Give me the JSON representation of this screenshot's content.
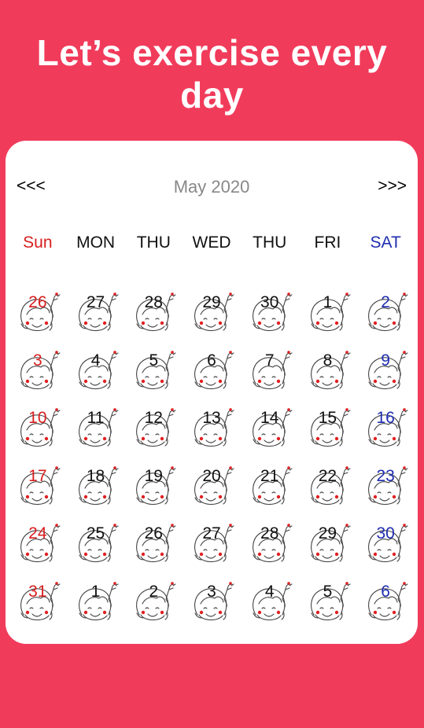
{
  "header": {
    "title": "Let’s exercise every day"
  },
  "calendar": {
    "prev_label": "<<<",
    "next_label": ">>>",
    "month_label": "May 2020",
    "weekdays": [
      "Sun",
      "MON",
      "THU",
      "WED",
      "THU",
      "FRI",
      "SAT"
    ],
    "weeks": [
      [
        "26",
        "27",
        "28",
        "29",
        "30",
        "1",
        "2"
      ],
      [
        "3",
        "4",
        "5",
        "6",
        "7",
        "8",
        "9"
      ],
      [
        "10",
        "11",
        "12",
        "13",
        "14",
        "15",
        "16"
      ],
      [
        "17",
        "18",
        "19",
        "20",
        "21",
        "22",
        "23"
      ],
      [
        "24",
        "25",
        "26",
        "27",
        "28",
        "29",
        "30"
      ],
      [
        "31",
        "1",
        "2",
        "3",
        "4",
        "5",
        "6"
      ]
    ],
    "cell_icon": "waving-girl-icon"
  },
  "colors": {
    "background": "#F13B5B",
    "sunday": "#D81E1E",
    "saturday": "#1F2DB0",
    "weekday": "#111111",
    "month_label": "#888888"
  }
}
